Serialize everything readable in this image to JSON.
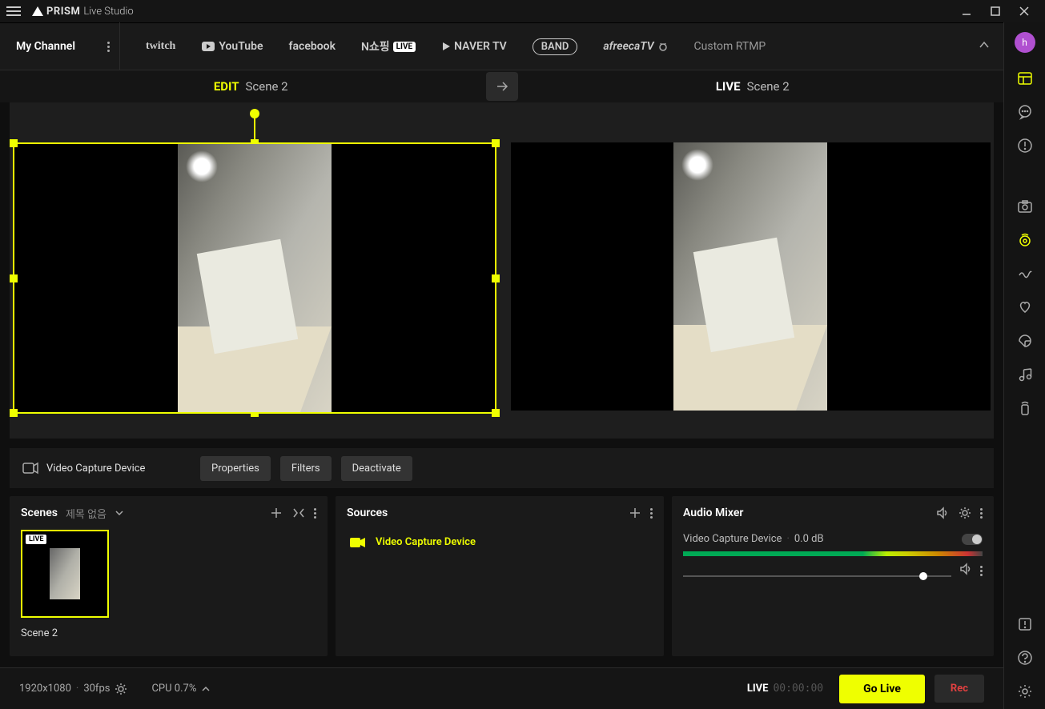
{
  "app": {
    "brand": "PRISM",
    "brand_suffix": "Live Studio"
  },
  "channel": {
    "title": "My Channel",
    "platforms": {
      "twitch": "twitch",
      "youtube": "YouTube",
      "facebook": "facebook",
      "shopping_prefix": "N쇼핑",
      "shopping_badge": "LIVE",
      "navertv": "NAVER TV",
      "band": "BAND",
      "afreeca": "afreecaTV",
      "custom": "Custom RTMP"
    }
  },
  "scene_header": {
    "edit_label": "EDIT",
    "edit_scene": "Scene 2",
    "live_label": "LIVE",
    "live_scene": "Scene 2"
  },
  "source_actions": {
    "selected": "Video Capture Device",
    "properties": "Properties",
    "filters": "Filters",
    "deactivate": "Deactivate"
  },
  "scenes_panel": {
    "title": "Scenes",
    "collection": "제목 없음",
    "items": [
      {
        "name": "Scene 2",
        "badge": "LIVE"
      }
    ]
  },
  "sources_panel": {
    "title": "Sources",
    "items": [
      {
        "name": "Video Capture Device"
      }
    ]
  },
  "mixer_panel": {
    "title": "Audio Mixer",
    "channels": [
      {
        "name": "Video Capture Device",
        "level": "0.0 dB"
      }
    ]
  },
  "bottom": {
    "resolution": "1920x1080",
    "fps": "30fps",
    "cpu": "CPU 0.7%",
    "live_label": "LIVE",
    "live_time": "00:00:00",
    "golive": "Go Live",
    "rec": "Rec"
  },
  "sidebar": {
    "avatar": "h"
  }
}
